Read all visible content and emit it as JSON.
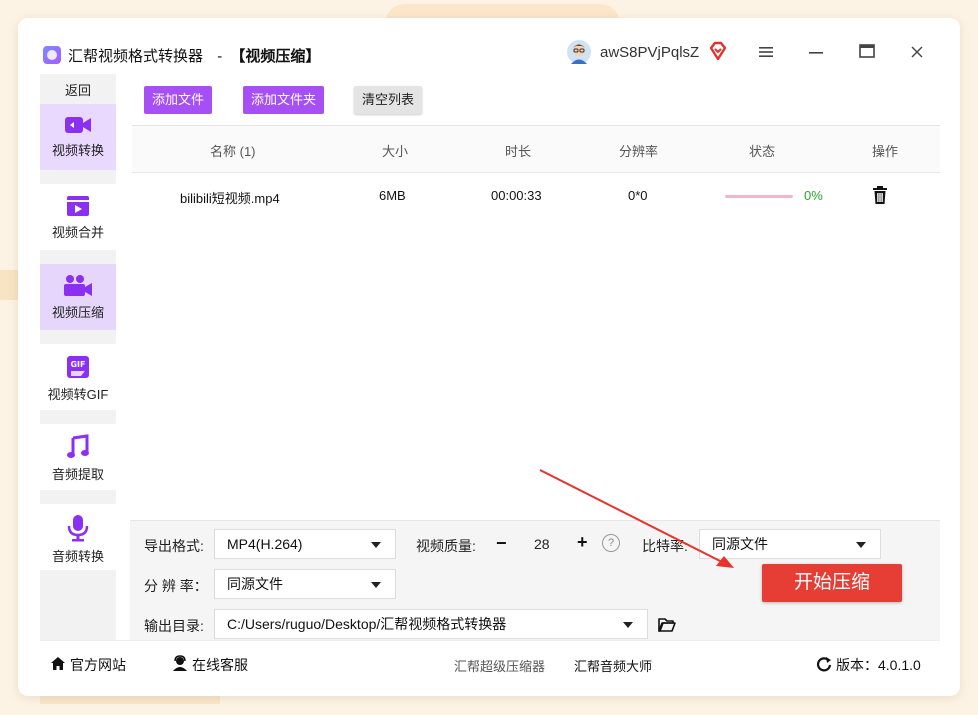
{
  "app": {
    "title": "汇帮视频格式转换器",
    "title_separator": "-",
    "module": "【视频压缩】",
    "username": "awS8PVjPqlsZ",
    "window_controls": [
      "menu-icon",
      "minimize-icon",
      "maximize-icon",
      "close-icon"
    ]
  },
  "sidebar": {
    "back_label": "返回",
    "items": [
      {
        "label": "视频转换",
        "icon": "video-convert-icon"
      },
      {
        "label": "视频合并",
        "icon": "video-merge-icon"
      },
      {
        "label": "视频压缩",
        "icon": "video-compress-icon"
      },
      {
        "label": "视频转GIF",
        "icon": "gif-icon"
      },
      {
        "label": "音频提取",
        "icon": "music-note-icon"
      },
      {
        "label": "音频转换",
        "icon": "microphone-icon"
      }
    ]
  },
  "toolbar": {
    "add_file": "添加文件",
    "add_folder": "添加文件夹",
    "clear_list": "清空列表"
  },
  "table": {
    "headers": [
      "名称 (1)",
      "大小",
      "时长",
      "分辨率",
      "状态",
      "操作"
    ],
    "rows": [
      {
        "name": "bilibili短视频.mp4",
        "size": "6MB",
        "duration": "00:00:33",
        "resolution": "0*0",
        "progress": "0%"
      }
    ]
  },
  "settings": {
    "format_label": "导出格式:",
    "format_value": "MP4(H.264)",
    "quality_label": "视频质量:",
    "quality_minus": "−",
    "quality_value": "28",
    "quality_plus": "+",
    "help_symbol": "?",
    "bitrate_label": "比特率:",
    "bitrate_value": "同源文件",
    "resolution_label": "分 辨 率：",
    "resolution_value": "同源文件",
    "output_label": "输出目录:",
    "output_path": "C:/Users/ruguo/Desktop/汇帮视频格式转换器",
    "start_button": "开始压缩"
  },
  "footer": {
    "website": "官方网站",
    "support": "在线客服",
    "link1": "汇帮超级压缩器",
    "link2": "汇帮音频大师",
    "version": "版本：4.0.1.0"
  },
  "colors": {
    "accent_purple": "#a64ff5",
    "start_red": "#e63d34",
    "progress_green": "#2aa52a"
  }
}
